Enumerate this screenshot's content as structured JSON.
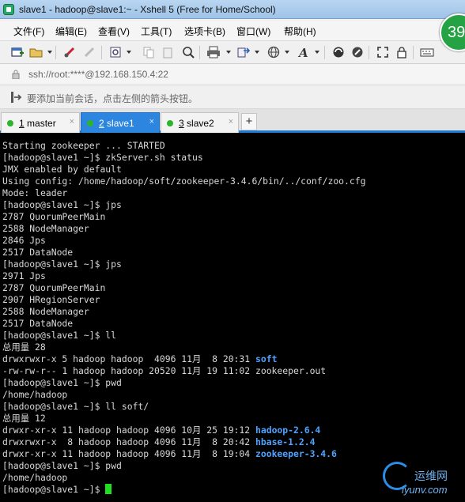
{
  "window": {
    "title": "slave1 - hadoop@slave1:~ - Xshell 5 (Free for Home/School)"
  },
  "menu": {
    "items": [
      "文件(F)",
      "编辑(E)",
      "查看(V)",
      "工具(T)",
      "选项卡(B)",
      "窗口(W)",
      "帮助(H)"
    ]
  },
  "badge": {
    "value": "39"
  },
  "address": {
    "text": "ssh://root:****@192.168.150.4:22"
  },
  "hint": {
    "text": "要添加当前会话，点击左侧的箭头按钮。"
  },
  "tabs": [
    {
      "num": "1",
      "name": " master",
      "active": false
    },
    {
      "num": "2",
      "name": " slave1",
      "active": true
    },
    {
      "num": "3",
      "name": " slave2",
      "active": false
    }
  ],
  "tab_add": "+",
  "tab_close": "×",
  "colors": {
    "accent": "#2c86e0",
    "terminal_bg": "#000000",
    "terminal_fg": "#d8d8d8",
    "dir": "#4fa3ff",
    "cursor": "#1fe01f"
  },
  "terminal": {
    "lines": [
      "Starting zookeeper ... STARTED",
      "[hadoop@slave1 ~]$ zkServer.sh status",
      "JMX enabled by default",
      "Using config: /home/hadoop/soft/zookeeper-3.4.6/bin/../conf/zoo.cfg",
      "Mode: leader",
      "[hadoop@slave1 ~]$ jps",
      "2787 QuorumPeerMain",
      "2588 NodeManager",
      "2846 Jps",
      "2517 DataNode",
      "[hadoop@slave1 ~]$ jps",
      "2971 Jps",
      "2787 QuorumPeerMain",
      "2907 HRegionServer",
      "2588 NodeManager",
      "2517 DataNode",
      "[hadoop@slave1 ~]$ ll",
      "总用量 28",
      {
        "prefix": "drwxrwxr-x 5 hadoop hadoop  4096 11月  8 20:31 ",
        "dir": "soft"
      },
      "-rw-rw-r-- 1 hadoop hadoop 20520 11月 19 11:02 zookeeper.out",
      "[hadoop@slave1 ~]$ pwd",
      "/home/hadoop",
      "[hadoop@slave1 ~]$ ll soft/",
      "总用量 12",
      {
        "prefix": "drwxr-xr-x 11 hadoop hadoop 4096 10月 25 19:12 ",
        "dir": "hadoop-2.6.4"
      },
      {
        "prefix": "drwxrwxr-x  8 hadoop hadoop 4096 11月  8 20:42 ",
        "dir": "hbase-1.2.4"
      },
      {
        "prefix": "drwxr-xr-x 11 hadoop hadoop 4096 11月  8 19:04 ",
        "dir": "zookeeper-3.4.6"
      },
      "[hadoop@slave1 ~]$ pwd",
      "/home/hadoop",
      "[hadoop@slave1 ~]$ "
    ]
  },
  "watermark": {
    "cn": "运维网",
    "en": "iyunv.com"
  }
}
